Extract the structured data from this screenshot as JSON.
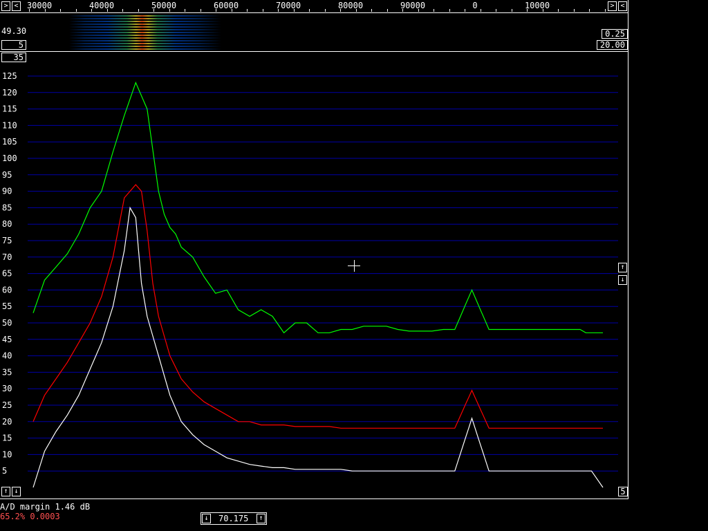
{
  "top": {
    "freq_labels": [
      "30000",
      "40000",
      "50000",
      "60000",
      "70000",
      "80000",
      "90000",
      "0",
      "10000"
    ],
    "left_value": "49.30",
    "left_box1": "5",
    "left_box2": "35",
    "right_box1": "0.25",
    "right_box2": "20.00"
  },
  "bottom": {
    "ad_margin": "A/D margin 1.46 dB",
    "status": "65.2% 0.0003",
    "center_freq": "70.175",
    "right_box": "5"
  },
  "colors": {
    "green": "#00ff00",
    "red": "#ff0000",
    "white": "#ffffff",
    "grid": "#0000a8"
  },
  "chart_data": {
    "type": "line",
    "ylim": [
      0,
      130
    ],
    "yticks": [
      5,
      10,
      15,
      20,
      25,
      30,
      35,
      40,
      45,
      50,
      55,
      60,
      65,
      70,
      75,
      80,
      85,
      90,
      95,
      100,
      105,
      110,
      115,
      120,
      125
    ],
    "x_range": [
      0,
      100
    ],
    "series": [
      {
        "color": "green",
        "x": [
          0,
          2,
          4,
          6,
          8,
          10,
          12,
          14,
          16,
          18,
          20,
          22,
          23,
          24,
          25,
          26,
          28,
          30,
          32,
          34,
          36,
          38,
          40,
          42,
          44,
          46,
          48,
          50,
          52,
          54,
          56,
          58,
          60,
          62,
          64,
          66,
          68,
          70,
          72,
          74,
          76,
          78,
          78.5,
          80,
          82,
          84,
          86,
          88,
          90,
          92,
          94,
          96,
          97,
          98,
          100
        ],
        "y": [
          53,
          63,
          67,
          71,
          77,
          85,
          90,
          102,
          113,
          123,
          115,
          90,
          83,
          79,
          77,
          73,
          70,
          64,
          59,
          60,
          54,
          52,
          54,
          52,
          47,
          50,
          50,
          47,
          47,
          48,
          48,
          49,
          49,
          49,
          48,
          47.5,
          47.5,
          47.5,
          48,
          48,
          48,
          48,
          48,
          48,
          48,
          48,
          48,
          48,
          48,
          48,
          48,
          48,
          47,
          47,
          47
        ]
      },
      {
        "color": "red",
        "x": [
          0,
          2,
          4,
          6,
          8,
          10,
          12,
          14,
          16,
          18,
          19,
          20,
          21,
          22,
          23,
          24,
          26,
          28,
          30,
          32,
          34,
          36,
          38,
          40,
          42,
          44,
          46,
          48,
          50,
          52,
          54,
          56,
          58,
          60,
          62,
          64,
          66,
          68,
          70,
          72,
          74,
          76,
          78,
          80,
          82,
          84,
          86,
          88,
          90,
          92,
          94,
          96,
          98,
          100
        ],
        "y": [
          20,
          28,
          33,
          38,
          44,
          50,
          58,
          70,
          88,
          92,
          90,
          78,
          62,
          52,
          46,
          40,
          33,
          29,
          26,
          24,
          22,
          20,
          20,
          19,
          19,
          19,
          18.5,
          18.5,
          18.5,
          18.5,
          18,
          18,
          18,
          18,
          18,
          18,
          18,
          18,
          18,
          18,
          18,
          18,
          18,
          18,
          18,
          18,
          18,
          18,
          18,
          18,
          18,
          18,
          18,
          18
        ]
      },
      {
        "color": "white",
        "x": [
          0,
          2,
          4,
          6,
          8,
          10,
          12,
          14,
          16,
          17,
          18,
          18.5,
          19,
          20,
          21,
          22,
          23,
          24,
          26,
          28,
          30,
          32,
          34,
          36,
          38,
          40,
          42,
          44,
          46,
          48,
          50,
          52,
          54,
          56,
          58,
          60,
          62,
          64,
          66,
          68,
          70,
          72,
          74,
          76,
          78,
          80,
          82,
          84,
          86,
          88,
          90,
          92,
          94,
          96,
          98,
          100
        ],
        "y": [
          0,
          11,
          17,
          22,
          28,
          36,
          44,
          55,
          72,
          85,
          82,
          72,
          62,
          52,
          46,
          40,
          34,
          28,
          20,
          16,
          13,
          11,
          9,
          8,
          7,
          6.5,
          6,
          6,
          5.5,
          5.5,
          5.5,
          5.5,
          5.5,
          5,
          5,
          5,
          5,
          5,
          5,
          5,
          5,
          5,
          5,
          5,
          5,
          5,
          5,
          5,
          5,
          5,
          5,
          5,
          5,
          5,
          5,
          0
        ]
      }
    ],
    "extra_peaks": [
      {
        "series": "green",
        "at": 77,
        "height": 60
      },
      {
        "series": "red",
        "at": 77,
        "height": 29.5
      },
      {
        "series": "white",
        "at": 77,
        "height": 21
      }
    ]
  }
}
